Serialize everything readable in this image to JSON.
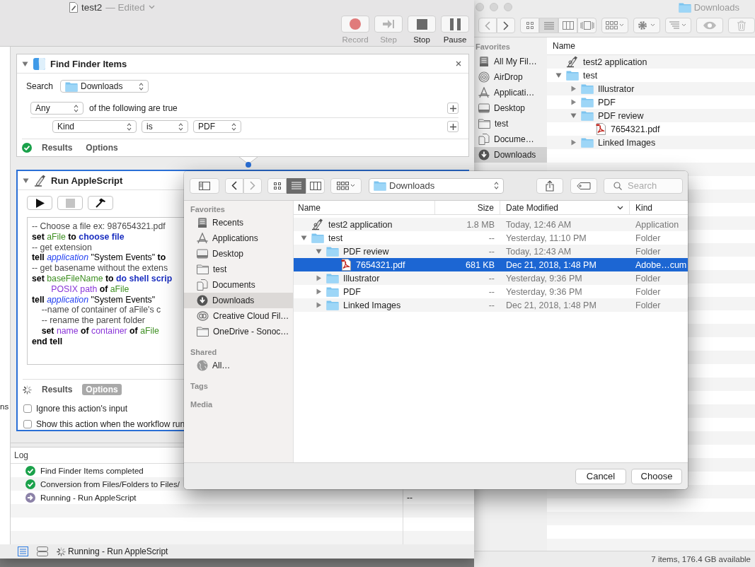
{
  "automator": {
    "title": "test2",
    "subtitle": "— Edited",
    "toolbar": [
      {
        "label": "Record",
        "kind": "record",
        "disabled": true
      },
      {
        "label": "Step",
        "kind": "step",
        "disabled": true
      },
      {
        "label": "Stop",
        "kind": "stop",
        "disabled": false
      },
      {
        "label": "Pause",
        "kind": "pause",
        "disabled": false
      }
    ],
    "library_fragment": "ns",
    "actions": [
      {
        "kind": "find",
        "title": "Find Finder Items",
        "selected": false,
        "expanded": true,
        "completed": true,
        "search_label": "Search",
        "search_location": "Downloads",
        "match": "Any",
        "match_text": "of the following are true",
        "criteria": [
          {
            "field": "Kind",
            "operator": "is",
            "value": "PDF"
          }
        ],
        "tabs": [
          {
            "label": "Results",
            "selected": false
          },
          {
            "label": "Options",
            "selected": false
          }
        ]
      },
      {
        "kind": "script",
        "title": "Run AppleScript",
        "selected": true,
        "expanded": true,
        "completed": false,
        "code": [
          [
            {
              "text": "-- Choose a file ex: 987654321.pdf",
              "kind": "cmt"
            }
          ],
          [
            {
              "text": "set ",
              "kind": "kw"
            },
            {
              "text": "aFile",
              "kind": "var"
            },
            {
              "text": " to ",
              "kind": "kw"
            },
            {
              "text": "choose file",
              "kind": "cmd"
            }
          ],
          [
            {
              "text": "-- get extension",
              "kind": "cmt"
            }
          ],
          [
            {
              "text": "tell ",
              "kind": "kw"
            },
            {
              "text": "application",
              "kind": "cls"
            },
            {
              "text": " \"System Events\" ",
              "kind": "str"
            },
            {
              "text": "to",
              "kind": "kw"
            }
          ],
          [
            {
              "text": "-- get basename without the extens",
              "kind": "cmt"
            }
          ],
          [
            {
              "text": "set ",
              "kind": "kw"
            },
            {
              "text": "baseFileName",
              "kind": "var"
            },
            {
              "text": " to ",
              "kind": "kw"
            },
            {
              "text": "do shell scrip",
              "kind": "cmd"
            }
          ],
          [
            {
              "text": "\t\tPOSIX path",
              "kind": "prop"
            },
            {
              "text": " of ",
              "kind": "kw"
            },
            {
              "text": "aFile",
              "kind": "var"
            }
          ],
          [
            {
              "text": "tell ",
              "kind": "kw"
            },
            {
              "text": "application",
              "kind": "cls"
            },
            {
              "text": " \"System Events\"",
              "kind": "str"
            }
          ],
          [
            {
              "text": "\t--name of container of aFile's c",
              "kind": "cmt"
            }
          ],
          [
            {
              "text": "\t-- rename the parent folder",
              "kind": "cmt"
            }
          ],
          [
            {
              "text": "\tset ",
              "kind": "kw"
            },
            {
              "text": "name",
              "kind": "prop"
            },
            {
              "text": " of ",
              "kind": "kw"
            },
            {
              "text": "container",
              "kind": "prop"
            },
            {
              "text": " of ",
              "kind": "kw"
            },
            {
              "text": "aFile",
              "kind": "var"
            }
          ],
          [
            {
              "text": "end tell",
              "kind": "kw"
            }
          ]
        ],
        "tabs": [
          {
            "label": "Results",
            "selected": false
          },
          {
            "label": "Options",
            "selected": true
          }
        ],
        "options": [
          {
            "label": "Ignore this action's input",
            "checked": false
          },
          {
            "label": "Show this action when the workflow run",
            "checked": false
          }
        ]
      }
    ],
    "log": {
      "title": "Log",
      "rows": [
        {
          "kind": "done",
          "text": "Find Finder Items completed"
        },
        {
          "kind": "done",
          "text": "Conversion from Files/Folders to Files/"
        },
        {
          "kind": "running",
          "text": "Running - Run AppleScript",
          "duration": "--"
        }
      ]
    },
    "status_bar": {
      "text": "Running - Run AppleScript",
      "running": true
    }
  },
  "finder": {
    "title": "Downloads",
    "view_modes": [
      {
        "selected": false
      },
      {
        "selected": true
      },
      {
        "selected": false
      },
      {
        "selected": false
      }
    ],
    "sidebar": {
      "heading": "Favorites",
      "items": [
        {
          "label": "All My Fil…",
          "selected": false
        },
        {
          "label": "AirDrop",
          "selected": false
        },
        {
          "label": "Applicati…",
          "selected": false
        },
        {
          "label": "Desktop",
          "selected": false
        },
        {
          "label": "test",
          "selected": false
        },
        {
          "label": "Docume…",
          "selected": false
        },
        {
          "label": "Downloads",
          "selected": true
        }
      ]
    },
    "column": "Name",
    "rows": [
      {
        "name": "test2 application",
        "kind": "app"
      },
      {
        "name": "test",
        "kind": "folder",
        "expanded": true,
        "children": [
          {
            "name": "Illustrator",
            "kind": "folder",
            "expanded": false
          },
          {
            "name": "PDF",
            "kind": "folder",
            "expanded": false
          },
          {
            "name": "PDF review",
            "kind": "folder",
            "expanded": true,
            "children": [
              {
                "name": "7654321.pdf",
                "kind": "pdf"
              }
            ]
          },
          {
            "name": "Linked Images",
            "kind": "folder",
            "expanded": false
          }
        ]
      }
    ],
    "status": "7 items, 176.4 GB available"
  },
  "dialog": {
    "view_modes": [
      {
        "selected": false
      },
      {
        "selected": true
      },
      {
        "selected": false
      }
    ],
    "location": "Downloads",
    "search_placeholder": "Search",
    "sidebar": [
      {
        "heading": "Favorites",
        "items": [
          {
            "label": "Recents",
            "selected": false
          },
          {
            "label": "Applications",
            "selected": false
          },
          {
            "label": "Desktop",
            "selected": false
          },
          {
            "label": "test",
            "selected": false
          },
          {
            "label": "Documents",
            "selected": false
          },
          {
            "label": "Downloads",
            "selected": true
          },
          {
            "label": "Creative Cloud Fil…",
            "selected": false
          },
          {
            "label": "OneDrive - Sonoc…",
            "selected": false
          }
        ]
      },
      {
        "heading": "Shared",
        "items": [
          {
            "label": "All…",
            "selected": false
          }
        ]
      },
      {
        "heading": "Tags"
      },
      {
        "heading": "Media"
      }
    ],
    "columns": [
      {
        "label": "Name",
        "sorted": false
      },
      {
        "label": "Size",
        "sorted": false
      },
      {
        "label": "Date Modified",
        "sorted": true
      },
      {
        "label": "Kind",
        "sorted": false
      }
    ],
    "rows": [
      {
        "name": "test2 application",
        "kind": "app",
        "size": "1.8 MB",
        "date": "Today, 12:46 AM",
        "type": "Application",
        "selected": false
      },
      {
        "name": "test",
        "kind": "folder",
        "expanded": true,
        "size": "--",
        "date": "Yesterday, 11:10 PM",
        "type": "Folder",
        "selected": false,
        "children": [
          {
            "name": "PDF review",
            "kind": "folder",
            "expanded": true,
            "size": "--",
            "date": "Today, 12:43 AM",
            "type": "Folder",
            "selected": false,
            "children": [
              {
                "name": "7654321.pdf",
                "kind": "pdf",
                "size": "681 KB",
                "date": "Dec 21, 2018, 1:48 PM",
                "type": "Adobe…cum",
                "selected": true
              }
            ]
          },
          {
            "name": "Illustrator",
            "kind": "folder",
            "expanded": false,
            "size": "--",
            "date": "Yesterday, 9:36 PM",
            "type": "Folder",
            "selected": false
          },
          {
            "name": "PDF",
            "kind": "folder",
            "expanded": false,
            "size": "--",
            "date": "Yesterday, 9:36 PM",
            "type": "Folder",
            "selected": false
          },
          {
            "name": "Linked Images",
            "kind": "folder",
            "expanded": false,
            "size": "--",
            "date": "Dec 21, 2018, 1:48 PM",
            "type": "Folder",
            "selected": false
          }
        ]
      }
    ],
    "buttons": [
      {
        "label": "Cancel"
      },
      {
        "label": "Choose"
      }
    ]
  }
}
